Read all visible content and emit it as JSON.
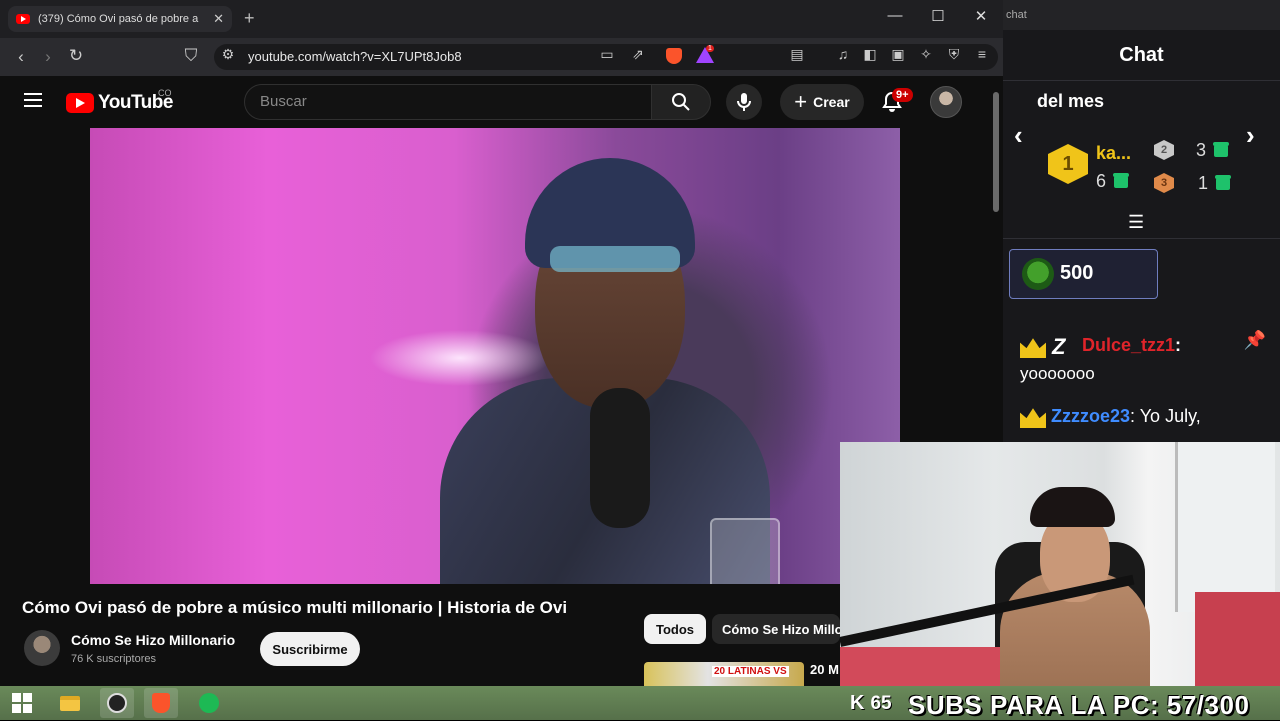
{
  "browser": {
    "tab_title": "(379) Cómo Ovi pasó de pobre a",
    "tab_close": "✕",
    "new_tab": "+",
    "window_controls": {
      "minimize": "—",
      "maximize": "☐",
      "close": "✕"
    },
    "url": "youtube.com/watch?v=XL7UPt8Job8",
    "shield_badge": "1"
  },
  "youtube": {
    "logo_text": "YouTube",
    "country_code": "CO",
    "search_placeholder": "Buscar",
    "create_label": "Crear",
    "notifications_badge": "9+",
    "video_title": "Cómo Ovi pasó de pobre a músico multi millonario | Historia de Ovi",
    "channel_name": "Cómo Se Hizo Millonario",
    "channel_subscribers": "76 K suscriptores",
    "subscribe_label": "Suscribirme",
    "chips": [
      "Todos",
      "Cómo Se Hizo Millonario"
    ],
    "recommended_thumb_label": "20 LATINAS VS",
    "recommended_title": "20 M"
  },
  "chat": {
    "tab_label": "chat",
    "title": "Chat",
    "leaderboard_label": "del mes",
    "rank1": {
      "rank": "1",
      "name": "ka...",
      "count": "6"
    },
    "rank2": {
      "rank": "2",
      "count": "3"
    },
    "rank3": {
      "rank": "3",
      "count": "1"
    },
    "points": "500",
    "messages": [
      {
        "user": "Dulce_tzz1",
        "text": "yooooooo"
      },
      {
        "user": "Zzzzoe23",
        "text": ": Yo July,"
      }
    ]
  },
  "overlay": {
    "viewer_count": "65",
    "subs_goal": "SUBS PARA LA PC: 57/300"
  },
  "colors": {
    "youtube_red": "#ff0000",
    "chat_gold": "#f0c419",
    "user1_color": "#e0242a",
    "user2_color": "#3f8cff",
    "gift_green": "#1ec26b"
  },
  "icons": [
    "back-icon",
    "forward-icon",
    "reload-icon",
    "bookmark-icon",
    "menu-icon",
    "search-icon",
    "mic-icon",
    "bell-icon",
    "windows-start-icon",
    "file-explorer-icon",
    "obs-icon",
    "brave-icon",
    "spotify-icon",
    "pin-icon"
  ]
}
